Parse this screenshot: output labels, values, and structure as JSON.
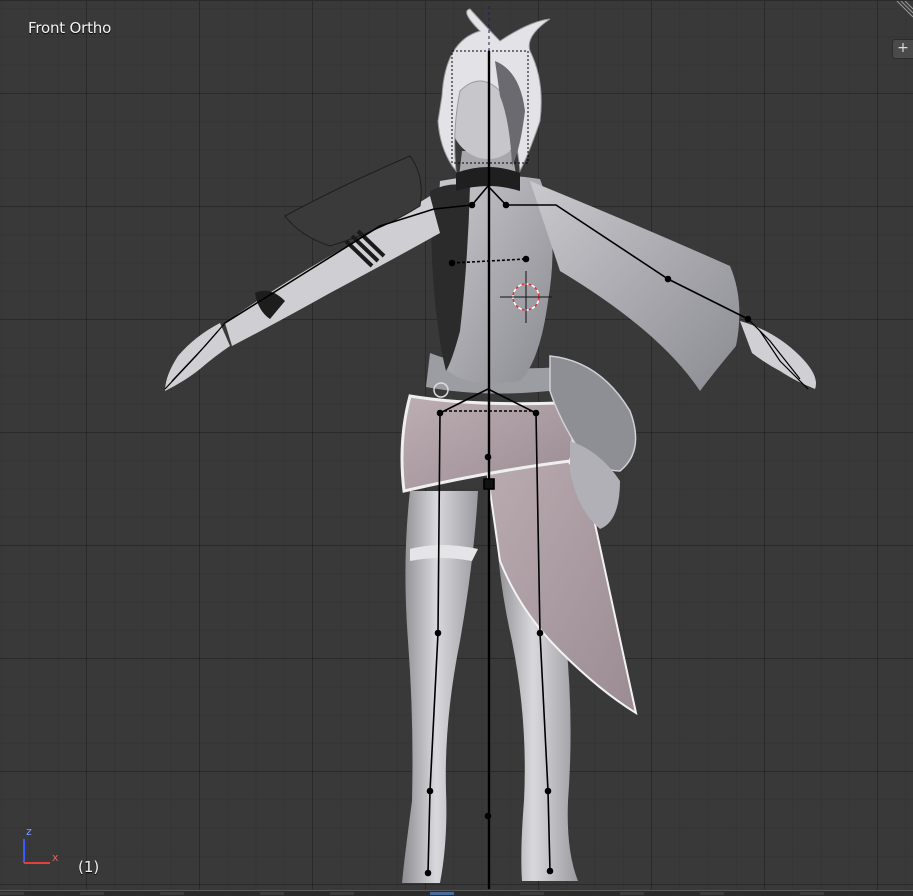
{
  "viewport": {
    "view_label": "Front Ortho",
    "frame_label": "(1)",
    "background_color": "#393939",
    "grid_color": "#2f2f2f"
  },
  "axis_gizmo": {
    "z_label": "z",
    "x_label": "x",
    "z_color": "#3b5bff",
    "x_color": "#e04040"
  },
  "toolbar": {
    "plus_icon": "plus-icon",
    "plus_glyph": "+",
    "corner_icon": "area-split-grip-icon"
  },
  "scene": {
    "model": "character-mesh",
    "armature": "armature-bones",
    "cursor": "3d-cursor"
  }
}
